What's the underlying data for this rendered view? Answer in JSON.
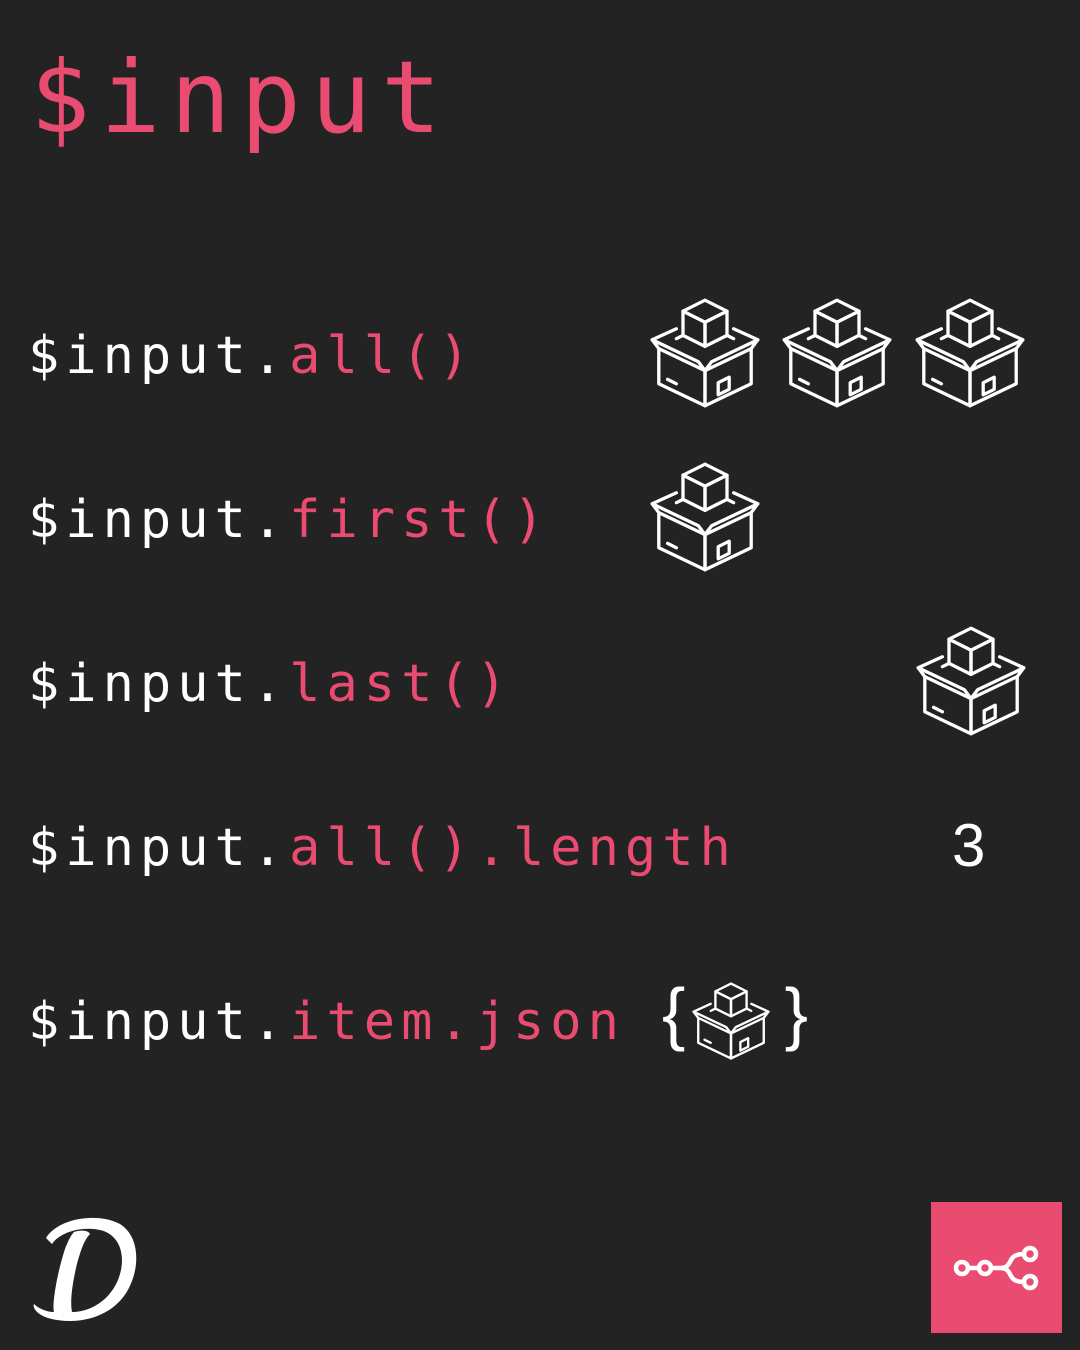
{
  "title": "$input",
  "rows": [
    {
      "base": "$input.",
      "method": "all()",
      "boxes": 3
    },
    {
      "base": "$input.",
      "method": "first()",
      "boxes": 1
    },
    {
      "base": "$input.",
      "method": "last()",
      "boxes": 1
    },
    {
      "base": "$input.",
      "method": "all().length",
      "result": "3"
    },
    {
      "base": "$input.",
      "method": "item.json",
      "braces": [
        "{",
        "}"
      ]
    }
  ],
  "icons": {
    "item": "package-box-icon",
    "brand_left": "d-logo-icon",
    "brand_right": "n8n-logo-icon"
  },
  "colors": {
    "background": "#232323",
    "accent": "#EA4B71",
    "text": "#FFFFFF"
  }
}
